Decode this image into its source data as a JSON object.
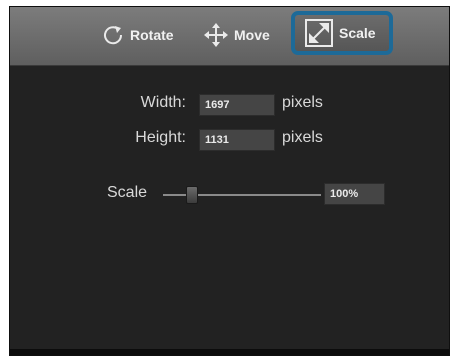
{
  "toolbar": {
    "rotate_label": "Rotate",
    "move_label": "Move",
    "scale_label": "Scale",
    "active_tool": "Scale"
  },
  "dimensions": {
    "width_label": "Width:",
    "width_value": "1697",
    "height_label": "Height:",
    "height_value": "1131",
    "unit": "pixels"
  },
  "scale": {
    "label": "Scale",
    "value": "100%"
  },
  "colors": {
    "accent": "#1d6a98",
    "panel_bg": "#222222",
    "toolbar_bg": "#6e6e6e"
  }
}
